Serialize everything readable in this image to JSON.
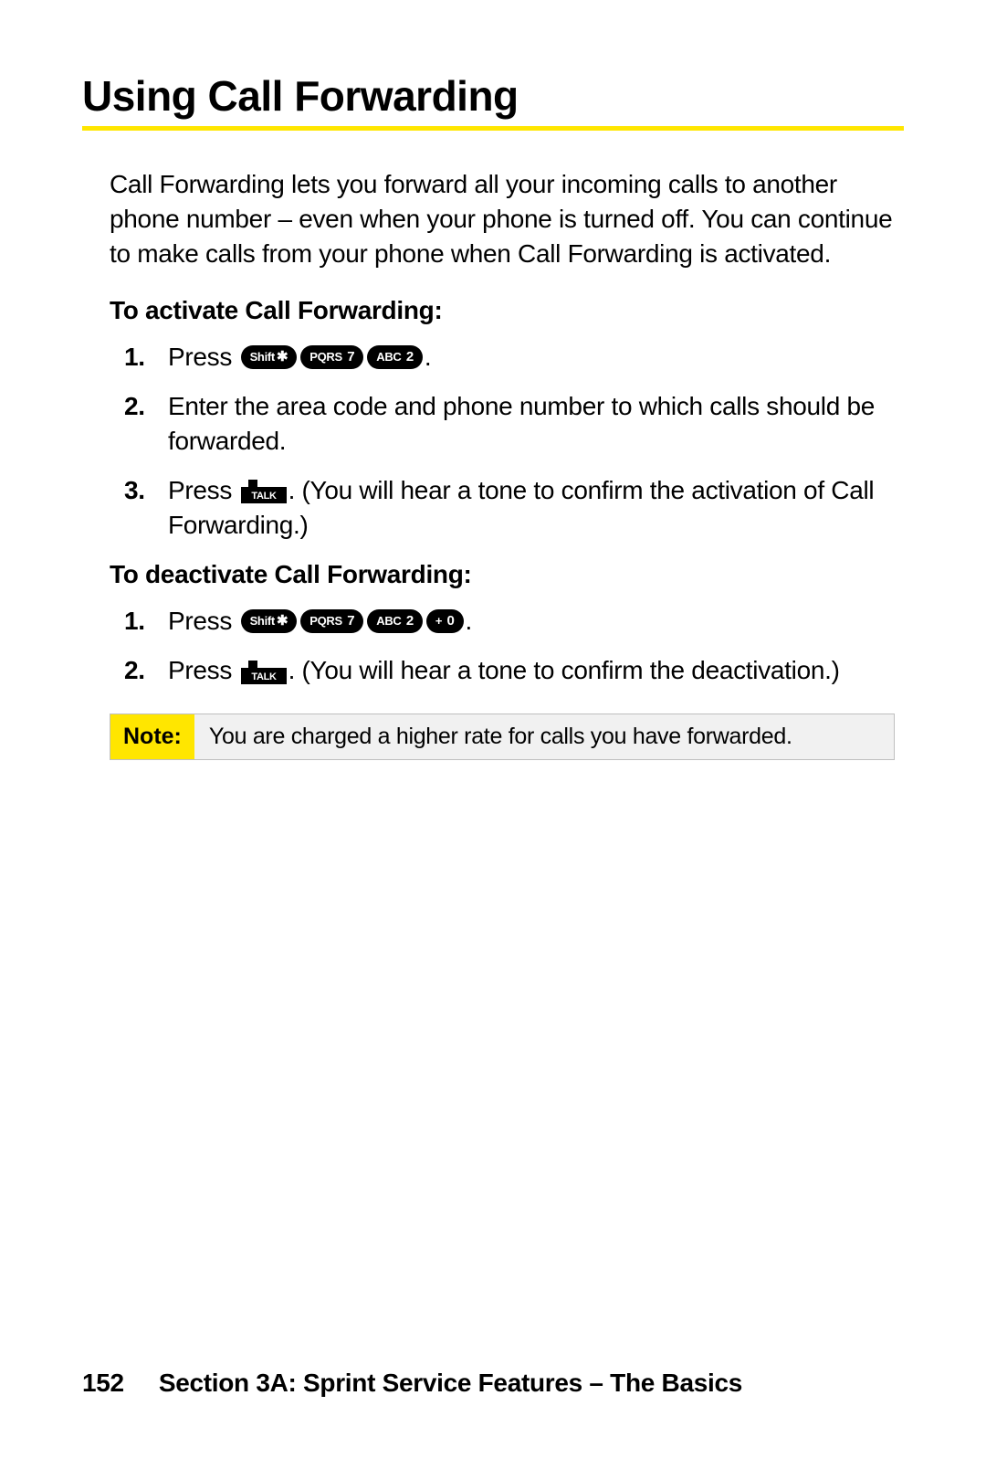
{
  "title": "Using Call Forwarding",
  "intro": "Call Forwarding lets you forward all your incoming calls to another phone number – even when your phone is turned off. You can continue to make calls from your phone when Call Forwarding is activated.",
  "activate": {
    "heading": "To activate Call Forwarding:",
    "steps": {
      "s1_press": "Press ",
      "s1_period": ".",
      "s2": "Enter the area code and phone number to which calls should be forwarded.",
      "s3_a": "Press ",
      "s3_b": ". (You will hear a tone to confirm the activation of Call Forwarding.)"
    }
  },
  "deactivate": {
    "heading": "To deactivate Call Forwarding:",
    "steps": {
      "s1_press": "Press ",
      "s1_period": ".",
      "s2_a": "Press ",
      "s2_b": ". (You will hear a tone to confirm the deactivation.)"
    }
  },
  "keys": {
    "shift_label": "Shift",
    "shift_sym": "✱",
    "pqrs_label": "PQRS",
    "pqrs_num": "7",
    "abc_label": "ABC",
    "abc_num": "2",
    "plus_label": "+",
    "plus_num": "0",
    "talk_label": "TALK"
  },
  "note": {
    "label": "Note:",
    "text": "You are charged a higher rate for calls you have forwarded."
  },
  "footer": {
    "page_number": "152",
    "section": "Section 3A: Sprint Service Features – The Basics"
  }
}
